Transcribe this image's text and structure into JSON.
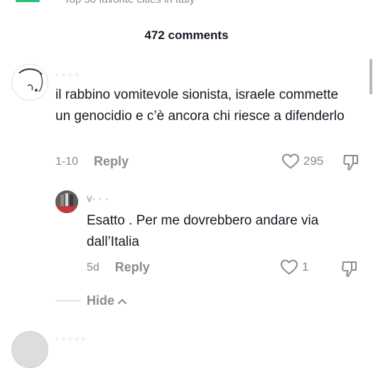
{
  "header": {
    "partial_title": "Top 50 favorite cities in Italy",
    "comments_count": "472 comments"
  },
  "comments": [
    {
      "username": "· · · ·",
      "text": "il rabbino vomitevole sionista, israele commette un genocidio e c’è ancora chi riesce a difenderlo",
      "date": "1-10",
      "reply_label": "Reply",
      "likes": "295",
      "icons": {
        "like": "heart-icon",
        "dislike": "thumbs-down-icon"
      }
    }
  ],
  "replies": [
    {
      "username": "v· · ·",
      "text": "Esatto . Per me dovrebbero andare via dall’Italia",
      "date": "5d",
      "reply_label": "Reply",
      "likes": "1",
      "icons": {
        "like": "heart-icon",
        "dislike": "thumbs-down-icon"
      }
    }
  ],
  "hide": {
    "label": "Hide",
    "icon": "chevron-up-icon"
  },
  "next_comment": {
    "username": "· · · · ·"
  },
  "colors": {
    "text": "#161823",
    "muted": "#8a8b91",
    "accent": "#2bbf7a"
  }
}
